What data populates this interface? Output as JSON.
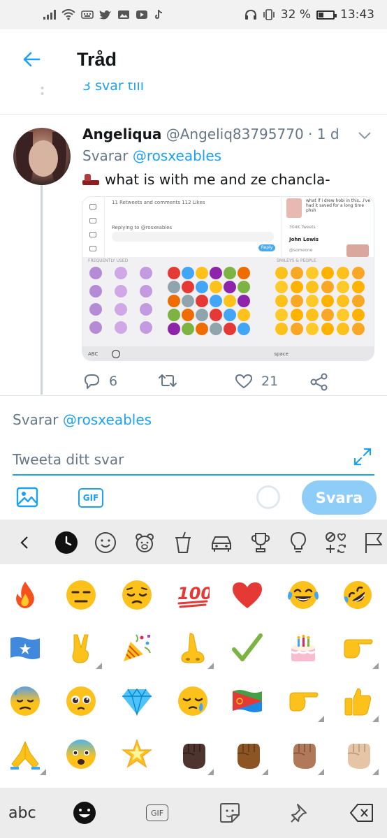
{
  "status_bar": {
    "battery_percent": "32 %",
    "time": "13:43"
  },
  "header": {
    "title": "Tråd"
  },
  "previous": {
    "replies_link": "3 svar till"
  },
  "tweet": {
    "name": "Angeliqua",
    "handle": "@Angeliq83795770 · 1 d",
    "replying_prefix": "Svarar ",
    "replying_mention": "@rosxeables",
    "text": "what is with me and ze chancla-",
    "reply_count": "6",
    "like_count": "21",
    "media": {
      "stats": "11 Retweets and comments  112 Likes",
      "replying": "Replying to @rosxeables",
      "reply_btn": "Reply",
      "side_text": "what if i drew hobi in this...i've had it saved for a long time phsh",
      "side_count": "304K Tweets",
      "side_name": "John Lewis",
      "side_sub": "@someone",
      "label_frequent": "FREQUENTLY USED",
      "label_smileys": "SMILEYS & PEOPLE",
      "bar_abc": "ABC",
      "bar_space": "space"
    }
  },
  "compose": {
    "replying_prefix": "Svarar ",
    "replying_mention": "@rosxeables",
    "placeholder": "Tweeta ditt svar",
    "gif_label": "GIF",
    "send_label": "Svara"
  },
  "keyboard": {
    "abc_label": "abc",
    "gif_label": "GIF"
  },
  "colors": {
    "accent": "#1da1f2",
    "send_disabled": "#8ecdf8",
    "keyboard_bar": "#ececec"
  }
}
